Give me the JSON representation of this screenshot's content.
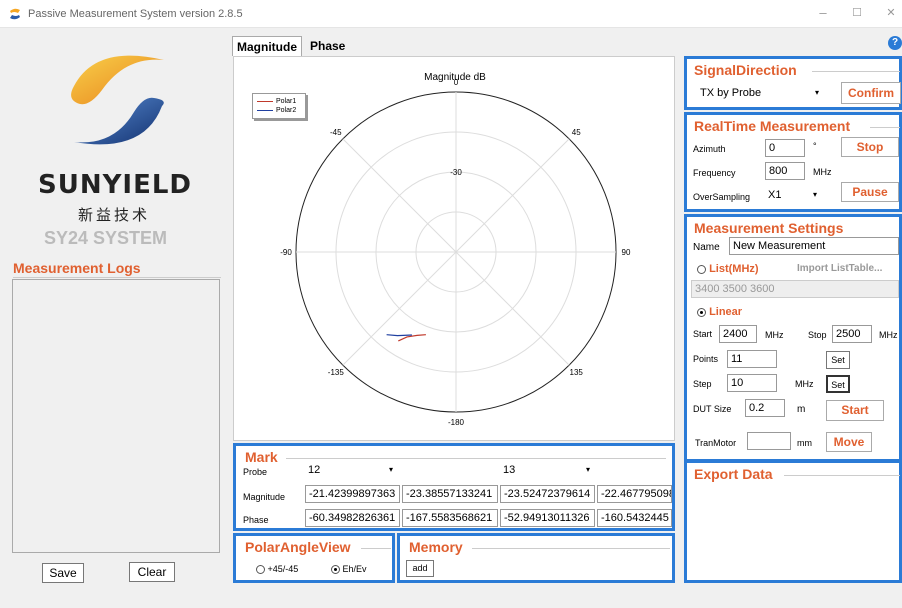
{
  "window": {
    "title": "Passive Measurement System  version 2.8.5",
    "minimize": "–",
    "maximize": "☐",
    "close": "✕"
  },
  "brand": {
    "name": "SUNYIELD",
    "name_cn": "新益技术",
    "system": "SY24 SYSTEM"
  },
  "logs": {
    "title": "Measurement Logs",
    "save": "Save",
    "clear": "Clear"
  },
  "tabs": [
    {
      "label": "Magnitude"
    },
    {
      "label": "Phase"
    }
  ],
  "chart_data": {
    "type": "polar",
    "title": "Magnitude dB",
    "angle_labels": [
      "0",
      "45",
      "90",
      "135",
      "-180",
      "-135",
      "-90",
      "-45"
    ],
    "radial_tick_label": "-30",
    "series": [
      {
        "name": "Polar1",
        "color": "#c0392b",
        "points": [
          [
            -160,
            -18
          ],
          [
            -155,
            -17
          ],
          [
            -150,
            -15.5
          ],
          [
            -147,
            -13.5
          ]
        ]
      },
      {
        "name": "Polar2",
        "color": "#1f3fa0",
        "points": [
          [
            -140,
            -13
          ],
          [
            -145,
            -14.5
          ],
          [
            -152,
            -16.5
          ]
        ]
      }
    ],
    "grid": true,
    "legend_position": "top-left"
  },
  "mark": {
    "title": "Mark",
    "probe_label": "Probe",
    "magnitude_label": "Magnitude",
    "phase_label": "Phase",
    "probes": [
      "12",
      "13"
    ],
    "magnitude": [
      "-21.42399897363",
      "-23.38557133241",
      "-23.52472379614",
      "-22.467795098"
    ],
    "phase": [
      "-60.34982826361",
      "-167.5583568621",
      "-52.94913011326",
      "-160.5432445"
    ]
  },
  "polar_view": {
    "title": "PolarAngleView",
    "opt1": "+45/-45",
    "opt2": "Eh/Ev"
  },
  "memory": {
    "title": "Memory",
    "add": "add"
  },
  "signal": {
    "title": "SignalDirection",
    "value": "TX by Probe",
    "confirm": "Confirm"
  },
  "realtime": {
    "title": "RealTime Measurement",
    "azimuth_label": "Azimuth",
    "azimuth": "0",
    "deg": "°",
    "frequency_label": "Frequency",
    "frequency": "800",
    "mhz": "MHz",
    "oversampling_label": "OverSampling",
    "oversampling": "X1",
    "stop": "Stop",
    "pause": "Pause"
  },
  "settings": {
    "title": "Measurement Settings",
    "name_label": "Name",
    "name": "New Measurement",
    "list_label": "List(MHz)",
    "import": "Import ListTable...",
    "list_values": "3400 3500 3600",
    "linear_label": "Linear",
    "start_label": "Start",
    "start": "2400",
    "start_unit": "MHz",
    "stop_label": "Stop",
    "stop": "2500",
    "stop_unit": "MHz",
    "points_label": "Points",
    "points": "11",
    "set": "Set",
    "step_label": "Step",
    "step": "10",
    "step_unit": "MHz",
    "dut_label": "DUT Size",
    "dut": "0.2",
    "dut_unit": "m",
    "start_btn": "Start",
    "tranmotor_label": "TranMotor",
    "tranmotor": "",
    "tranmotor_unit": "mm",
    "move": "Move"
  },
  "export": {
    "title": "Export Data"
  },
  "help": "?"
}
